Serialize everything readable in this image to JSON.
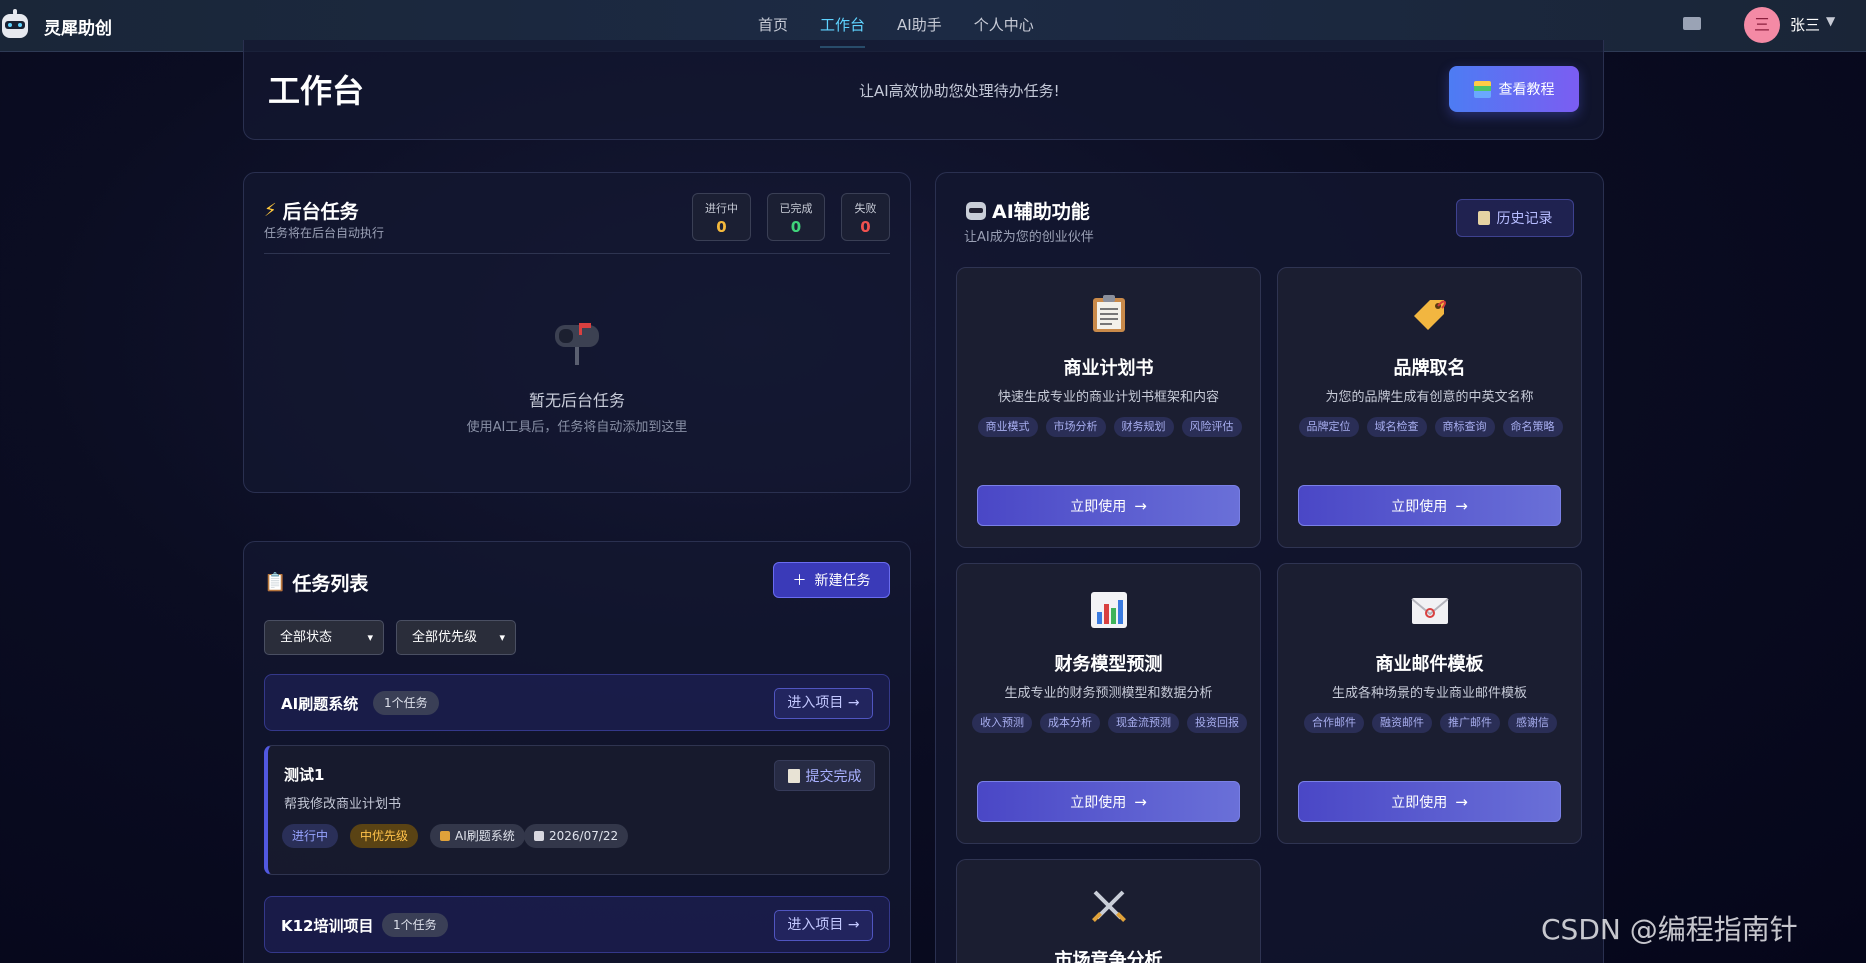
{
  "header": {
    "brand": "灵犀助创",
    "nav": [
      "首页",
      "工作台",
      "AI助手",
      "个人中心"
    ],
    "active_nav": "工作台",
    "avatar_glyph": "三",
    "username": "张三",
    "caret": "▼"
  },
  "hero": {
    "title": "工作台",
    "subtitle": "让AI高效协助您处理待办任务!",
    "tutorial_button": "查看教程"
  },
  "background_tasks": {
    "title": "后台任务",
    "subtitle": "任务将在后台自动执行",
    "stats": [
      {
        "label": "进行中",
        "value": "0",
        "color": "#f5b93c"
      },
      {
        "label": "已完成",
        "value": "0",
        "color": "#3fd27a"
      },
      {
        "label": "失败",
        "value": "0",
        "color": "#f0514f"
      }
    ],
    "empty_title": "暂无后台任务",
    "empty_subtitle": "使用AI工具后，任务将自动添加到这里"
  },
  "task_list": {
    "title": "任务列表",
    "new_task_button": "新建任务",
    "filters": {
      "status": "全部状态",
      "priority": "全部优先级"
    },
    "projects": [
      {
        "name": "AI刷题系统",
        "count": "1个任务",
        "enter": "进入项目 →"
      },
      {
        "name": "K12培训项目",
        "count": "1个任务",
        "enter": "进入项目 →"
      }
    ],
    "task": {
      "title": "测试1",
      "description": "帮我修改商业计划书",
      "submit": "提交完成",
      "status": "进行中",
      "priority": "中优先级",
      "project": "AI刷题系统",
      "date": "2026/07/22"
    }
  },
  "ai_panel": {
    "title": "AI辅助功能",
    "subtitle": "让AI成为您的创业伙伴",
    "history_button": "历史记录",
    "use_label": "立即使用",
    "arrow": "→",
    "cards": [
      {
        "title": "商业计划书",
        "desc": "快速生成专业的商业计划书框架和内容",
        "tags": [
          "商业模式",
          "市场分析",
          "财务规划",
          "风险评估"
        ],
        "icon": "clipboard-icon"
      },
      {
        "title": "品牌取名",
        "desc": "为您的品牌生成有创意的中英文名称",
        "tags": [
          "品牌定位",
          "域名检查",
          "商标查询",
          "命名策略"
        ],
        "icon": "tag-icon"
      },
      {
        "title": "财务模型预测",
        "desc": "生成专业的财务预测模型和数据分析",
        "tags": [
          "收入预测",
          "成本分析",
          "现金流预测",
          "投资回报"
        ],
        "icon": "bar-chart-icon"
      },
      {
        "title": "商业邮件模板",
        "desc": "生成各种场景的专业商业邮件模板",
        "tags": [
          "合作邮件",
          "融资邮件",
          "推广邮件",
          "感谢信"
        ],
        "icon": "envelope-icon"
      },
      {
        "title": "市场竞争分析",
        "icon": "crossed-swords-icon"
      }
    ]
  },
  "watermark": "CSDN @编程指南针"
}
